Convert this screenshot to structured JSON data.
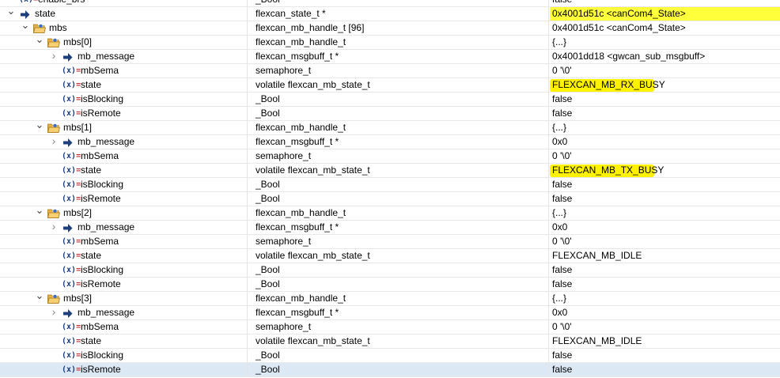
{
  "rows": [
    {
      "depth": 0,
      "expander": "none",
      "icon": "variable-icon",
      "name": "enable_brs",
      "type": "_Bool",
      "value": "false",
      "partial": true
    },
    {
      "depth": 0,
      "expander": "expanded",
      "icon": "pointer-arrow-icon",
      "name": "state",
      "type": "flexcan_state_t *",
      "value": "0x4001d51c <canCom4_State>",
      "highlight": "row"
    },
    {
      "depth": 1,
      "expander": "expanded",
      "icon": "struct-icon",
      "name": "mbs",
      "type": "flexcan_mb_handle_t [96]",
      "value": "0x4001d51c <canCom4_State>"
    },
    {
      "depth": 2,
      "expander": "expanded",
      "icon": "struct-icon",
      "name": "mbs[0]",
      "type": "flexcan_mb_handle_t",
      "value": "{...}"
    },
    {
      "depth": 3,
      "expander": "collapsed",
      "icon": "pointer-arrow-icon",
      "name": "mb_message",
      "type": "flexcan_msgbuff_t *",
      "value": "0x4001dd18 <gwcan_sub_msgbuff>"
    },
    {
      "depth": 3,
      "expander": "none",
      "icon": "variable-icon",
      "name": "mbSema",
      "type": "semaphore_t",
      "value": "0 '\\0'"
    },
    {
      "depth": 3,
      "expander": "none",
      "icon": "variable-icon",
      "name": "state",
      "type": "volatile flexcan_mb_state_t",
      "value": "FLEXCAN_MB_RX_BUSY",
      "highlight": "marker"
    },
    {
      "depth": 3,
      "expander": "none",
      "icon": "variable-icon",
      "name": "isBlocking",
      "type": "_Bool",
      "value": "false"
    },
    {
      "depth": 3,
      "expander": "none",
      "icon": "variable-icon",
      "name": "isRemote",
      "type": "_Bool",
      "value": "false"
    },
    {
      "depth": 2,
      "expander": "expanded",
      "icon": "struct-icon",
      "name": "mbs[1]",
      "type": "flexcan_mb_handle_t",
      "value": "{...}"
    },
    {
      "depth": 3,
      "expander": "collapsed",
      "icon": "pointer-arrow-icon",
      "name": "mb_message",
      "type": "flexcan_msgbuff_t *",
      "value": "0x0"
    },
    {
      "depth": 3,
      "expander": "none",
      "icon": "variable-icon",
      "name": "mbSema",
      "type": "semaphore_t",
      "value": "0 '\\0'"
    },
    {
      "depth": 3,
      "expander": "none",
      "icon": "variable-icon",
      "name": "state",
      "type": "volatile flexcan_mb_state_t",
      "value": "FLEXCAN_MB_TX_BUSY",
      "highlight": "marker"
    },
    {
      "depth": 3,
      "expander": "none",
      "icon": "variable-icon",
      "name": "isBlocking",
      "type": "_Bool",
      "value": "false"
    },
    {
      "depth": 3,
      "expander": "none",
      "icon": "variable-icon",
      "name": "isRemote",
      "type": "_Bool",
      "value": "false"
    },
    {
      "depth": 2,
      "expander": "expanded",
      "icon": "struct-icon",
      "name": "mbs[2]",
      "type": "flexcan_mb_handle_t",
      "value": "{...}"
    },
    {
      "depth": 3,
      "expander": "collapsed",
      "icon": "pointer-arrow-icon",
      "name": "mb_message",
      "type": "flexcan_msgbuff_t *",
      "value": "0x0"
    },
    {
      "depth": 3,
      "expander": "none",
      "icon": "variable-icon",
      "name": "mbSema",
      "type": "semaphore_t",
      "value": "0 '\\0'"
    },
    {
      "depth": 3,
      "expander": "none",
      "icon": "variable-icon",
      "name": "state",
      "type": "volatile flexcan_mb_state_t",
      "value": "FLEXCAN_MB_IDLE"
    },
    {
      "depth": 3,
      "expander": "none",
      "icon": "variable-icon",
      "name": "isBlocking",
      "type": "_Bool",
      "value": "false"
    },
    {
      "depth": 3,
      "expander": "none",
      "icon": "variable-icon",
      "name": "isRemote",
      "type": "_Bool",
      "value": "false"
    },
    {
      "depth": 2,
      "expander": "expanded",
      "icon": "struct-icon",
      "name": "mbs[3]",
      "type": "flexcan_mb_handle_t",
      "value": "{...}"
    },
    {
      "depth": 3,
      "expander": "collapsed",
      "icon": "pointer-arrow-icon",
      "name": "mb_message",
      "type": "flexcan_msgbuff_t *",
      "value": "0x0"
    },
    {
      "depth": 3,
      "expander": "none",
      "icon": "variable-icon",
      "name": "mbSema",
      "type": "semaphore_t",
      "value": "0 '\\0'"
    },
    {
      "depth": 3,
      "expander": "none",
      "icon": "variable-icon",
      "name": "state",
      "type": "volatile flexcan_mb_state_t",
      "value": "FLEXCAN_MB_IDLE"
    },
    {
      "depth": 3,
      "expander": "none",
      "icon": "variable-icon",
      "name": "isBlocking",
      "type": "_Bool",
      "value": "false"
    },
    {
      "depth": 3,
      "expander": "none",
      "icon": "variable-icon",
      "name": "isRemote",
      "type": "_Bool",
      "value": "false",
      "selected": true
    }
  ],
  "colors": {
    "row_highlight": "#ffff3c",
    "marker_highlight": "#fff200",
    "selection": "#dde8f5",
    "pointer_arrow": "#1f3f7a",
    "struct_icon": "#e8b04a"
  }
}
